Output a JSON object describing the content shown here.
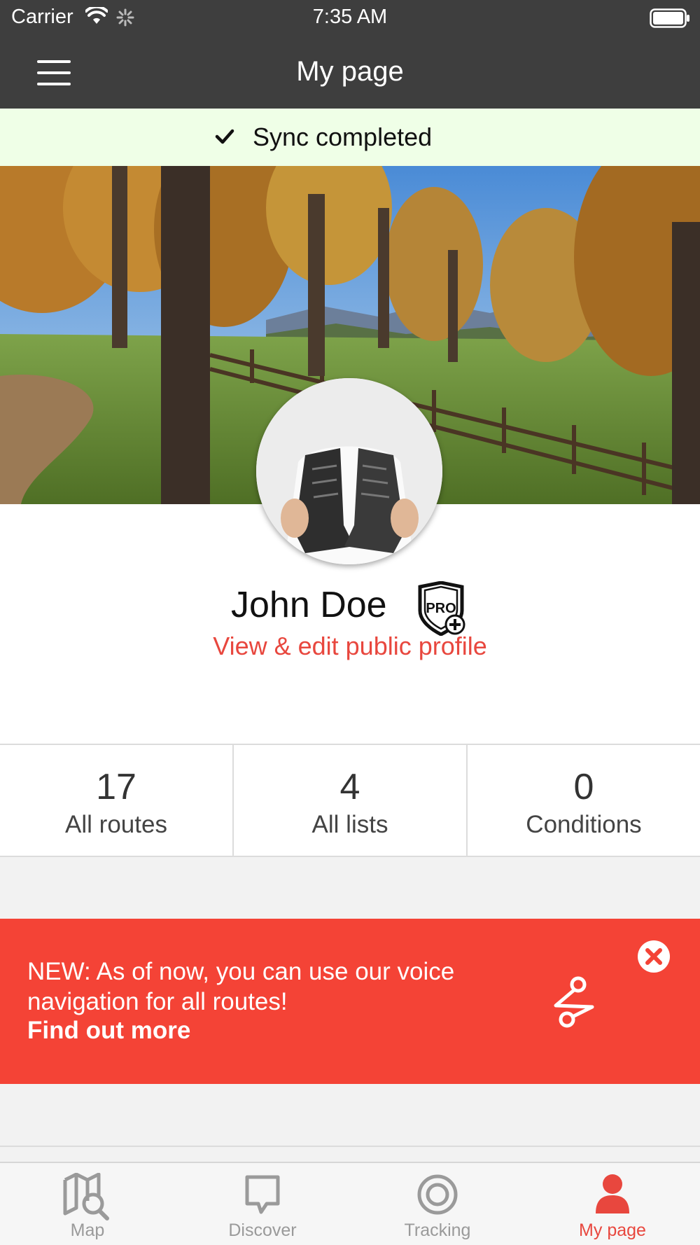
{
  "status_bar": {
    "carrier": "Carrier",
    "time": "7:35 AM"
  },
  "nav": {
    "title": "My page"
  },
  "sync": {
    "message": "Sync completed"
  },
  "profile": {
    "name": "John Doe",
    "badge": "PRO",
    "edit_link": "View & edit public profile"
  },
  "stats": [
    {
      "value": "17",
      "label": "All routes"
    },
    {
      "value": "4",
      "label": "All lists"
    },
    {
      "value": "0",
      "label": "Conditions"
    }
  ],
  "promo": {
    "text": "NEW: As of now, you can use our voice navigation for all routes!",
    "link": "Find out more"
  },
  "tabs": [
    {
      "label": "Map",
      "icon": "map-search-icon",
      "active": false
    },
    {
      "label": "Discover",
      "icon": "speech-bubble-icon",
      "active": false
    },
    {
      "label": "Tracking",
      "icon": "target-icon",
      "active": false
    },
    {
      "label": "My page",
      "icon": "person-icon",
      "active": true
    }
  ],
  "colors": {
    "header_bg": "#3e3e3e",
    "accent": "#e8473e",
    "promo_bg": "#f44336",
    "sync_bg": "#efffe7"
  }
}
